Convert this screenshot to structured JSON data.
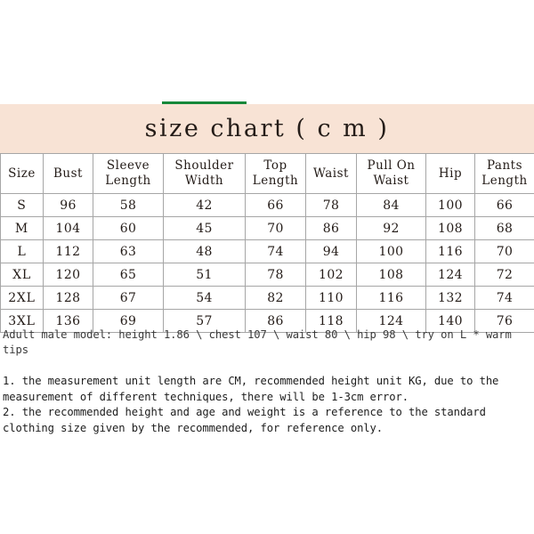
{
  "banner": {
    "title": "size chart ( c m )",
    "background_color": "#F8E3D5",
    "accent_rule_color": "#17883A"
  },
  "table": {
    "headers": [
      "Size",
      "Bust",
      "Sleeve Length",
      "Shoulder Width",
      "Top Length",
      "Waist",
      "Pull On Waist",
      "Hip",
      "Pants Length"
    ],
    "rows": [
      [
        "S",
        "96",
        "58",
        "42",
        "66",
        "78",
        "84",
        "100",
        "66"
      ],
      [
        "M",
        "104",
        "60",
        "45",
        "70",
        "86",
        "92",
        "108",
        "68"
      ],
      [
        "L",
        "112",
        "63",
        "48",
        "74",
        "94",
        "100",
        "116",
        "70"
      ],
      [
        "XL",
        "120",
        "65",
        "51",
        "78",
        "102",
        "108",
        "124",
        "72"
      ],
      [
        "2XL",
        "128",
        "67",
        "54",
        "82",
        "110",
        "116",
        "132",
        "74"
      ],
      [
        "3XL",
        "136",
        "69",
        "57",
        "86",
        "118",
        "124",
        "140",
        "76"
      ]
    ]
  },
  "notes": {
    "model": "Adult male model: height 1.86 \\ chest 107 \\ waist 80 \\ hip 98 \\ try on L * warm tips",
    "items": [
      "1. the measurement unit length are CM, recommended height unit KG, due to the measurement of different techniques, there will be 1-3cm error.",
      "2. the recommended height and age and weight is a reference to the standard clothing size given by the recommended, for reference only."
    ]
  }
}
